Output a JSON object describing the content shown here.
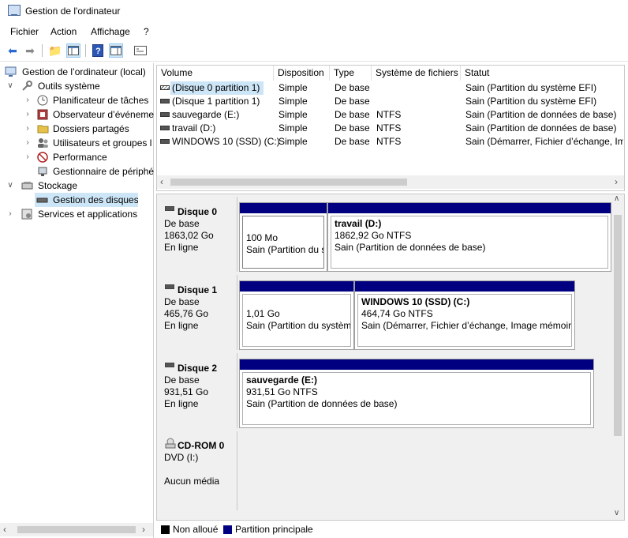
{
  "window": {
    "title": "Gestion de l'ordinateur"
  },
  "menu": [
    "Fichier",
    "Action",
    "Affichage",
    "?"
  ],
  "toolbar": {
    "icons": [
      "back-arrow-icon",
      "forward-arrow-icon",
      "up-folder-icon",
      "show-hide-tree-icon",
      "help-icon",
      "properties-icon",
      "console-icon"
    ]
  },
  "tree": {
    "root": "Gestion de l’ordinateur (local)",
    "outils": "Outils système",
    "planif": "Planificateur de tâches",
    "observ": "Observateur d’événeme",
    "dossiers": "Dossiers partagés",
    "users": "Utilisateurs et groupes l",
    "perf": "Performance",
    "gestperiph": "Gestionnaire de périphé",
    "stockage": "Stockage",
    "disques": "Gestion des disques",
    "services": "Services et applications"
  },
  "volume_table": {
    "headers": [
      "Volume",
      "Disposition",
      "Type",
      "Système de fichiers",
      "Statut"
    ],
    "rows": [
      {
        "volume": "(Disque 0 partition 1)",
        "disposition": "Simple",
        "type": "De base",
        "fs": "",
        "statut": "Sain (Partition du système EFI)"
      },
      {
        "volume": "(Disque 1 partition 1)",
        "disposition": "Simple",
        "type": "De base",
        "fs": "",
        "statut": "Sain (Partition du système EFI)"
      },
      {
        "volume": "sauvegarde (E:)",
        "disposition": "Simple",
        "type": "De base",
        "fs": "NTFS",
        "statut": "Sain (Partition de données de base)"
      },
      {
        "volume": "travail (D:)",
        "disposition": "Simple",
        "type": "De base",
        "fs": "NTFS",
        "statut": "Sain (Partition de données de base)"
      },
      {
        "volume": "WINDOWS 10 (SSD) (C:)",
        "disposition": "Simple",
        "type": "De base",
        "fs": "NTFS",
        "statut": "Sain (Démarrer, Fichier d’échange, Ima"
      }
    ]
  },
  "disks": [
    {
      "name": "Disque 0",
      "type": "De base",
      "size": "1863,02 Go",
      "state": "En ligne",
      "parts": [
        {
          "title": "",
          "size": "100 Mo",
          "status": "Sain (Partition du s"
        },
        {
          "title": "travail  (D:)",
          "size": "1862,92 Go NTFS",
          "status": "Sain (Partition de données de base)"
        }
      ]
    },
    {
      "name": "Disque 1",
      "type": "De base",
      "size": "465,76 Go",
      "state": "En ligne",
      "parts": [
        {
          "title": "",
          "size": "1,01 Go",
          "status": "Sain (Partition du systèm"
        },
        {
          "title": "WINDOWS 10 (SSD)  (C:)",
          "size": "464,74 Go NTFS",
          "status": "Sain (Démarrer, Fichier d’échange, Image mémoir"
        }
      ]
    },
    {
      "name": "Disque 2",
      "type": "De base",
      "size": "931,51 Go",
      "state": "En ligne",
      "parts": [
        {
          "title": "sauvegarde  (E:)",
          "size": "931,51 Go NTFS",
          "status": "Sain (Partition de données de base)"
        }
      ]
    },
    {
      "name": "CD-ROM 0",
      "type": "DVD (I:)",
      "size": "",
      "state": "Aucun média",
      "parts": []
    }
  ],
  "legend": {
    "unallocated": "Non alloué",
    "primary": "Partition principale"
  },
  "colors": {
    "primary_partition": "#000080",
    "unallocated": "#000000",
    "selection": "#cde6f7"
  }
}
